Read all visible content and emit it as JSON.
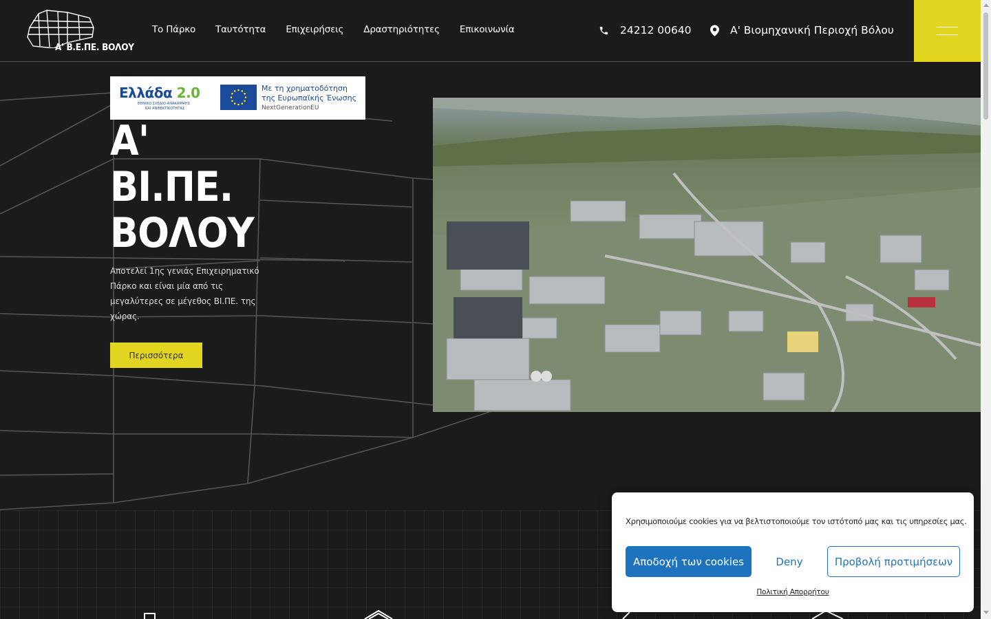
{
  "header": {
    "logo_text": "Α' Β.Ε.ΠΕ. ΒΟΛΟΥ",
    "nav": [
      "Το Πάρκο",
      "Ταυτότητα",
      "Επιχειρήσεις",
      "Δραστηριότητες",
      "Επικοινωνία"
    ],
    "phone": "24212 00640",
    "address": "Α' Βιομηχανική Περιοχή Βόλου",
    "icons": {
      "phone": "phone-icon",
      "location": "map-pin-icon",
      "menu": "hamburger-menu-icon"
    },
    "accent_color": "#e2d51f"
  },
  "badge": {
    "title_main": "Ελλάδα ",
    "title_version": "2.0",
    "subtitle_1": "ΕΘΝΙΚΟ ΣΧΕΔΙΟ ΑΝΑΚΑΜΨΗΣ",
    "subtitle_2": "ΚΑΙ ΑΝΘΕΚΤΙΚΟΤΗΤΑΣ",
    "eu_line_1": "Με τη χρηματοδότηση",
    "eu_line_2": "της Ευρωπαϊκής Ένωσης",
    "eu_line_3": "NextGenerationEU"
  },
  "hero": {
    "title_line_1": "Α'",
    "title_line_2": "ΒΙ.ΠΕ.",
    "title_line_3": "ΒΟΛΟΥ",
    "description": "Αποτελεί 1ης γενιάς Επιχειρηματικό Πάρκο και είναι μία από τις μεγαλύτερες σε μέγεθος ΒΙ.ΠΕ. της χώρας.",
    "button_label": "Περισσότερα"
  },
  "cookie_banner": {
    "text": "Χρησιμοποιούμε cookies για να βελτιστοποιούμε τον ιστότοπό μας και τις υπηρεσίες μας.",
    "accept_label": "Αποδοχή των cookies",
    "deny_label": "Deny",
    "preferences_label": "Προβολή προτιμήσεων",
    "privacy_link": "Πολιτική Απορρήτου",
    "primary_color": "#1e73be"
  }
}
